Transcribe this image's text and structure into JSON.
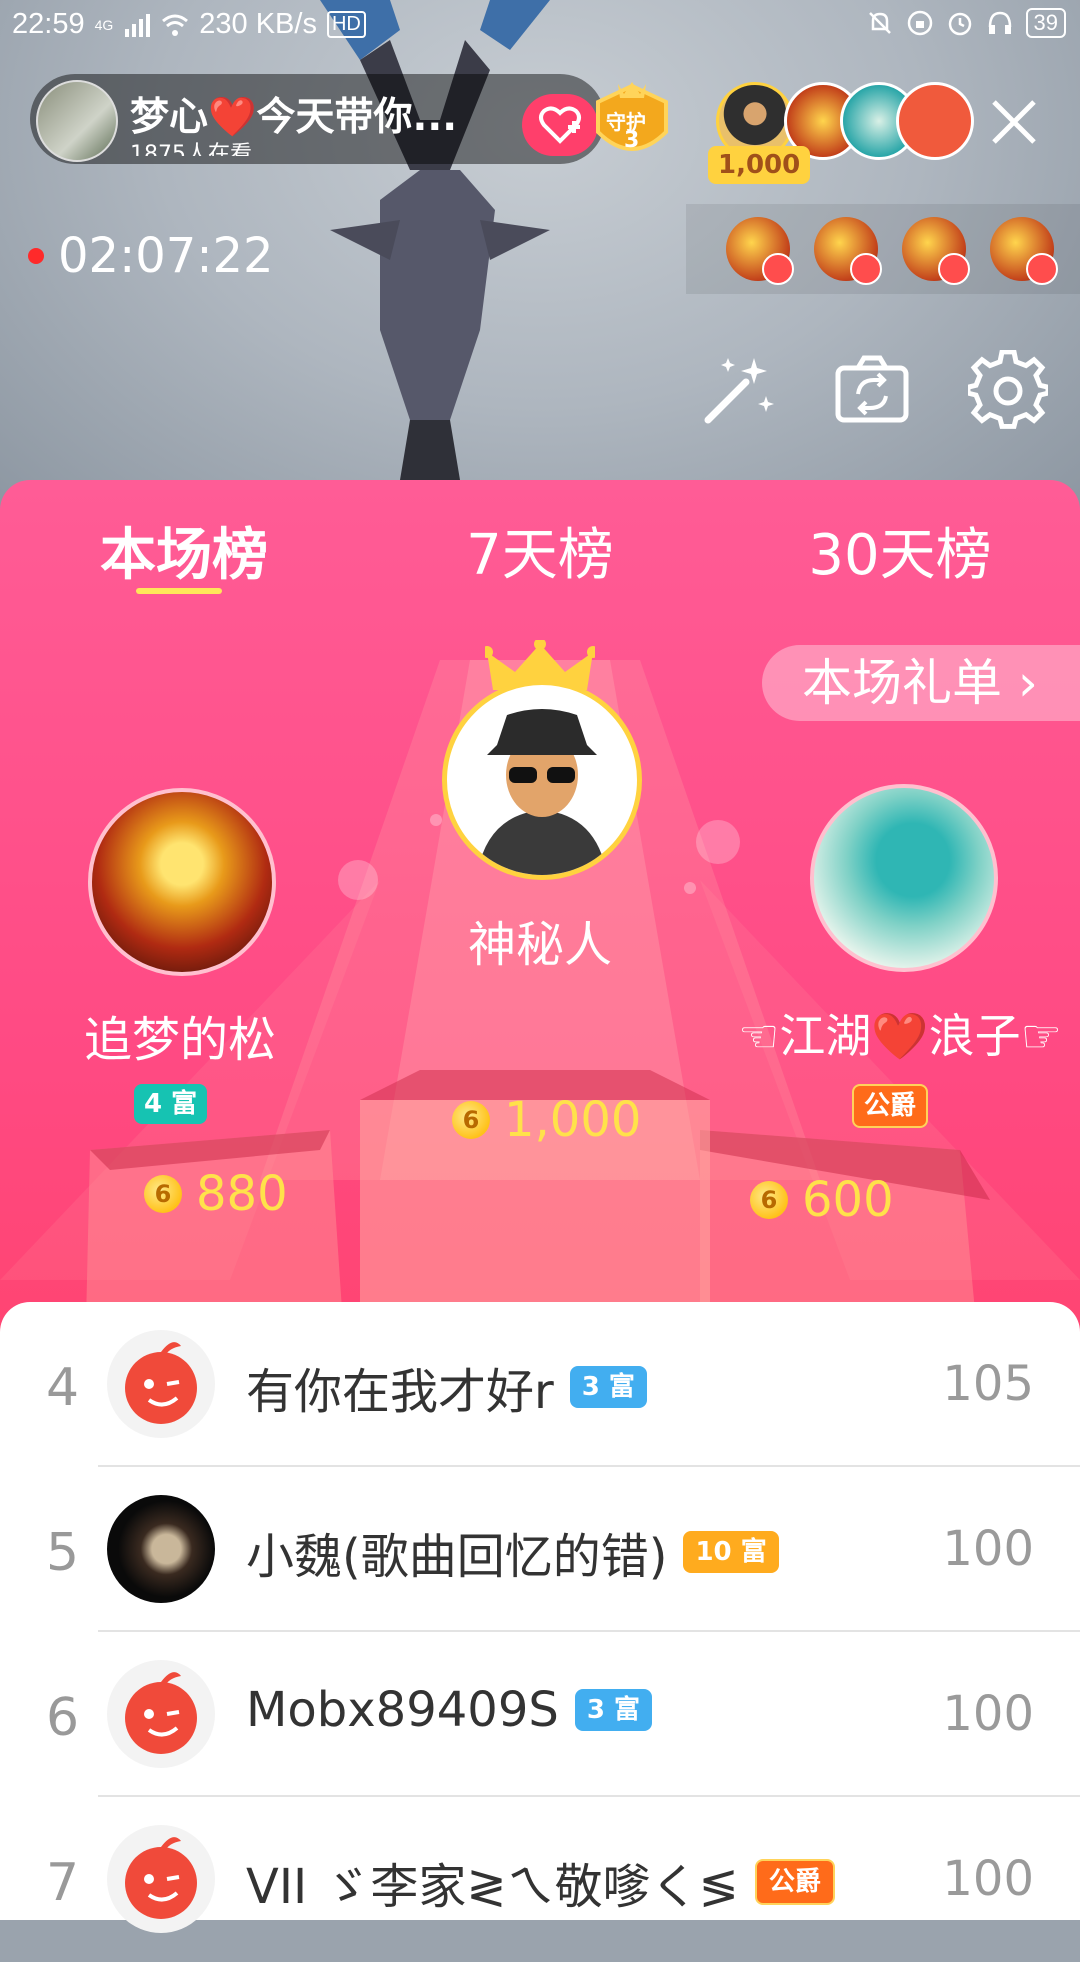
{
  "status_bar": {
    "time": "22:59",
    "network_type": "4G",
    "speed": "230 KB/s",
    "hd": "HD",
    "battery": "39"
  },
  "host": {
    "name": "梦心❤️今天带你...",
    "viewers_text": "1875人在看",
    "guard_label": "守护",
    "guard_count": "3"
  },
  "top_contributor_value": "1,000",
  "live_duration": "02:07:22",
  "tabs": [
    {
      "label": "本场榜",
      "active": true
    },
    {
      "label": "7天榜",
      "active": false
    },
    {
      "label": "30天榜",
      "active": false
    }
  ],
  "gift_list_button": "本场礼单 ›",
  "podium": {
    "first": {
      "name": "神秘人",
      "coins": "1,000"
    },
    "second": {
      "name": "追梦的松",
      "badge": "4 富",
      "coins": "880"
    },
    "third": {
      "name": "☜江湖❤️浪子☞",
      "badge": "公爵",
      "coins": "600"
    }
  },
  "ranking": [
    {
      "rank": "4",
      "name": "有你在我才好r",
      "badge": "3 富",
      "badge_color": "#42aef0",
      "score": "105",
      "avatar": "app-default"
    },
    {
      "rank": "5",
      "name": "小魏(歌曲回忆的错)",
      "badge": "10 富",
      "badge_color": "#ffab1e",
      "score": "100",
      "avatar": "photo"
    },
    {
      "rank": "6",
      "name": "Mobx89409S",
      "badge": "3 富",
      "badge_color": "#42aef0",
      "score": "100",
      "avatar": "app-default"
    },
    {
      "rank": "7",
      "name": "VII ゞ李家≷ㄟ敬嗲く≶",
      "badge": "公爵",
      "badge_color": "#ff6b1a",
      "score": "100",
      "avatar": "app-default"
    }
  ]
}
